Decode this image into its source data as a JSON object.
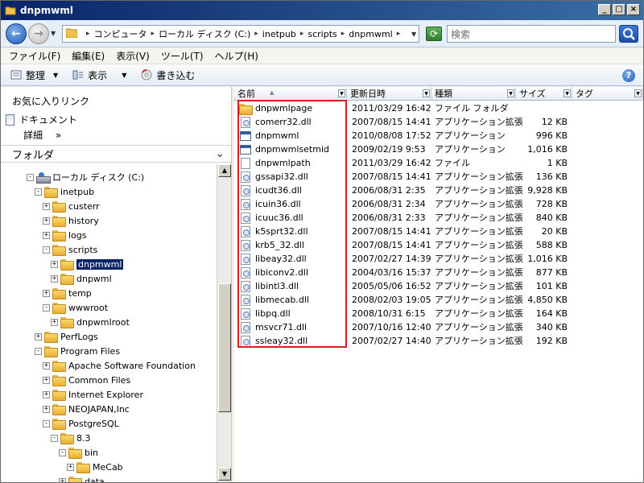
{
  "window": {
    "title": "dnpmwml"
  },
  "address": {
    "crumbs": [
      "コンピュータ",
      "ローカル ディスク (C:)",
      "inetpub",
      "scripts",
      "dnpmwml"
    ],
    "search_placeholder": "検索"
  },
  "menu": [
    "ファイル(F)",
    "編集(E)",
    "表示(V)",
    "ツール(T)",
    "ヘルプ(H)"
  ],
  "toolbar": {
    "organize": "整理",
    "views": "表示",
    "burn": "書き込む"
  },
  "left": {
    "favorites": "お気に入りリンク",
    "documents": "ドキュメント",
    "details": "詳細",
    "details_more": "»",
    "folders_header": "フォルダ",
    "tree": [
      {
        "label": "ローカル ディスク (C:)",
        "indent": 0,
        "exp": "-",
        "type": "drive"
      },
      {
        "label": "inetpub",
        "indent": 1,
        "exp": "-",
        "type": "folder"
      },
      {
        "label": "custerr",
        "indent": 2,
        "exp": "+",
        "type": "folder"
      },
      {
        "label": "history",
        "indent": 2,
        "exp": "+",
        "type": "folder"
      },
      {
        "label": "logs",
        "indent": 2,
        "exp": "+",
        "type": "folder"
      },
      {
        "label": "scripts",
        "indent": 2,
        "exp": "-",
        "type": "folder"
      },
      {
        "label": "dnpmwml",
        "indent": 3,
        "exp": "+",
        "type": "folder",
        "selected": true
      },
      {
        "label": "dnpwml",
        "indent": 3,
        "exp": "+",
        "type": "folder"
      },
      {
        "label": "temp",
        "indent": 2,
        "exp": "+",
        "type": "folder"
      },
      {
        "label": "wwwroot",
        "indent": 2,
        "exp": "-",
        "type": "folder"
      },
      {
        "label": "dnpwmlroot",
        "indent": 3,
        "exp": "+",
        "type": "folder"
      },
      {
        "label": "PerfLogs",
        "indent": 1,
        "exp": "+",
        "type": "folder"
      },
      {
        "label": "Program Files",
        "indent": 1,
        "exp": "-",
        "type": "folder"
      },
      {
        "label": "Apache Software Foundation",
        "indent": 2,
        "exp": "+",
        "type": "folder"
      },
      {
        "label": "Common Files",
        "indent": 2,
        "exp": "+",
        "type": "folder"
      },
      {
        "label": "Internet Explorer",
        "indent": 2,
        "exp": "+",
        "type": "folder"
      },
      {
        "label": "NEOJAPAN,Inc",
        "indent": 2,
        "exp": "+",
        "type": "folder"
      },
      {
        "label": "PostgreSQL",
        "indent": 2,
        "exp": "-",
        "type": "folder"
      },
      {
        "label": "8.3",
        "indent": 3,
        "exp": "-",
        "type": "folder"
      },
      {
        "label": "bin",
        "indent": 4,
        "exp": "-",
        "type": "folder"
      },
      {
        "label": "MeCab",
        "indent": 5,
        "exp": "+",
        "type": "folder"
      },
      {
        "label": "data",
        "indent": 4,
        "exp": "+",
        "type": "folder"
      }
    ]
  },
  "columns": {
    "name": "名前",
    "date": "更新日時",
    "type": "種類",
    "size": "サイズ",
    "tags": "タグ"
  },
  "files": [
    {
      "name": "dnpwmlpage",
      "date": "2011/03/29 16:42",
      "type": "ファイル フォルダ",
      "size": "",
      "icon": "folder"
    },
    {
      "name": "comerr32.dll",
      "date": "2007/08/15 14:41",
      "type": "アプリケーション拡張",
      "size": "12 KB",
      "icon": "dll"
    },
    {
      "name": "dnpmwml",
      "date": "2010/08/08 17:52",
      "type": "アプリケーション",
      "size": "996 KB",
      "icon": "app"
    },
    {
      "name": "dnpmwmlsetmid",
      "date": "2009/02/19 9:53",
      "type": "アプリケーション",
      "size": "1,016 KB",
      "icon": "app"
    },
    {
      "name": "dnpwmlpath",
      "date": "2011/03/29 16:42",
      "type": "ファイル",
      "size": "1 KB",
      "icon": "file"
    },
    {
      "name": "gssapi32.dll",
      "date": "2007/08/15 14:41",
      "type": "アプリケーション拡張",
      "size": "136 KB",
      "icon": "dll"
    },
    {
      "name": "icudt36.dll",
      "date": "2006/08/31 2:35",
      "type": "アプリケーション拡張",
      "size": "9,928 KB",
      "icon": "dll"
    },
    {
      "name": "icuin36.dll",
      "date": "2006/08/31 2:34",
      "type": "アプリケーション拡張",
      "size": "728 KB",
      "icon": "dll"
    },
    {
      "name": "icuuc36.dll",
      "date": "2006/08/31 2:33",
      "type": "アプリケーション拡張",
      "size": "840 KB",
      "icon": "dll"
    },
    {
      "name": "k5sprt32.dll",
      "date": "2007/08/15 14:41",
      "type": "アプリケーション拡張",
      "size": "20 KB",
      "icon": "dll"
    },
    {
      "name": "krb5_32.dll",
      "date": "2007/08/15 14:41",
      "type": "アプリケーション拡張",
      "size": "588 KB",
      "icon": "dll"
    },
    {
      "name": "libeay32.dll",
      "date": "2007/02/27 14:39",
      "type": "アプリケーション拡張",
      "size": "1,016 KB",
      "icon": "dll"
    },
    {
      "name": "libiconv2.dll",
      "date": "2004/03/16 15:37",
      "type": "アプリケーション拡張",
      "size": "877 KB",
      "icon": "dll"
    },
    {
      "name": "libintl3.dll",
      "date": "2005/05/06 16:52",
      "type": "アプリケーション拡張",
      "size": "101 KB",
      "icon": "dll"
    },
    {
      "name": "libmecab.dll",
      "date": "2008/02/03 19:05",
      "type": "アプリケーション拡張",
      "size": "4,850 KB",
      "icon": "dll"
    },
    {
      "name": "libpq.dll",
      "date": "2008/10/31 6:15",
      "type": "アプリケーション拡張",
      "size": "164 KB",
      "icon": "dll"
    },
    {
      "name": "msvcr71.dll",
      "date": "2007/10/16 12:40",
      "type": "アプリケーション拡張",
      "size": "340 KB",
      "icon": "dll"
    },
    {
      "name": "ssleay32.dll",
      "date": "2007/02/27 14:40",
      "type": "アプリケーション拡張",
      "size": "192 KB",
      "icon": "dll"
    }
  ],
  "colors": {
    "title_bar": "#0a246a",
    "highlight_box": "#d42020",
    "selection": "#0a246a"
  }
}
